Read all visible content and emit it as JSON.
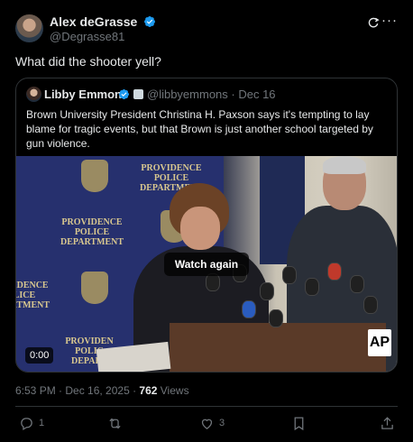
{
  "author": {
    "name": "Alex deGrasse",
    "handle": "@Degrasse81",
    "verified_color": "#1d9bf0"
  },
  "post_text": "What did the shooter yell?",
  "quoted_post": {
    "name": "Libby Emmons",
    "handle_date": "@libbyemmons · Dec 16",
    "text": "Brown University President Christina H. Paxson says it's tempting to lay blame for tragic events, but that Brown is just another school targeted by gun violence.",
    "video": {
      "overlay_button": "Watch again",
      "timestamp": "0:00",
      "corner_logo": "AP",
      "backdrop_text_1": "PROVIDENCE\nPOLICE\nDEPARTMENT",
      "backdrop_text_2": "PROVIDENCE\nPOLICE\nDEPARTMENT",
      "backdrop_text_3": "PROVIDENCE\nPOLICE\nDEPARTMENT",
      "backdrop_text_4": "PROVIDEN\nPOLIC\nDEPART"
    }
  },
  "meta": {
    "datetime": "6:53 PM · Dec 16, 2025 · ",
    "views_count": "762",
    "views_label": " Views"
  },
  "actions": {
    "replies": "1",
    "reposts": "",
    "likes": "3"
  },
  "icons": [
    "verified-badge-icon",
    "grok-icon",
    "more-icon",
    "reply-icon",
    "repost-icon",
    "like-icon",
    "bookmark-icon",
    "share-icon"
  ]
}
